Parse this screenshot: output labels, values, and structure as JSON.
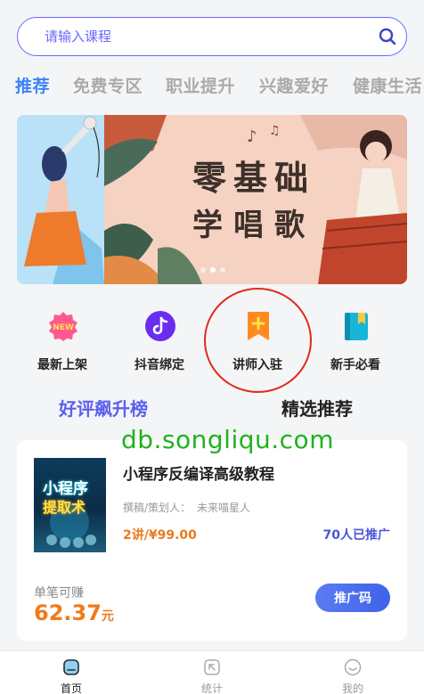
{
  "search": {
    "placeholder": "请输入课程"
  },
  "tabs": [
    "推荐",
    "免费专区",
    "职业提升",
    "兴趣爱好",
    "健康生活"
  ],
  "banner": {
    "line1": "零基础",
    "line2": "学唱歌"
  },
  "quick_icons": [
    {
      "label": "最新上架",
      "icon": "new-badge-icon",
      "badge": "NEW"
    },
    {
      "label": "抖音绑定",
      "icon": "tiktok-icon"
    },
    {
      "label": "讲师入驻",
      "icon": "bookmark-plus-icon"
    },
    {
      "label": "新手必看",
      "icon": "book-icon"
    }
  ],
  "sections": {
    "left": "好评飙升榜",
    "right": "精选推荐"
  },
  "watermark": "db.songliqu.com",
  "course": {
    "cover_line1": "小程序",
    "cover_line2": "提取术",
    "title": "小程序反编译高级教程",
    "author_label": "撰稿/策划人：",
    "author": "未来喵星人",
    "price": "2讲/¥99.00",
    "promoted": "70人已推广",
    "earn_label": "单笔可赚",
    "earn_value": "62.37",
    "earn_unit": "元",
    "promote_button": "推广码"
  },
  "nav": [
    {
      "label": "首页",
      "icon": "home-icon",
      "active": true
    },
    {
      "label": "统计",
      "icon": "stats-icon",
      "active": false
    },
    {
      "label": "我的",
      "icon": "profile-icon",
      "active": false
    }
  ],
  "colors": {
    "accent": "#3c84f6",
    "search_border": "#6b66ff",
    "price": "#e87b1e",
    "highlight_ring": "#e02b1d",
    "watermark": "#1fb31f"
  }
}
